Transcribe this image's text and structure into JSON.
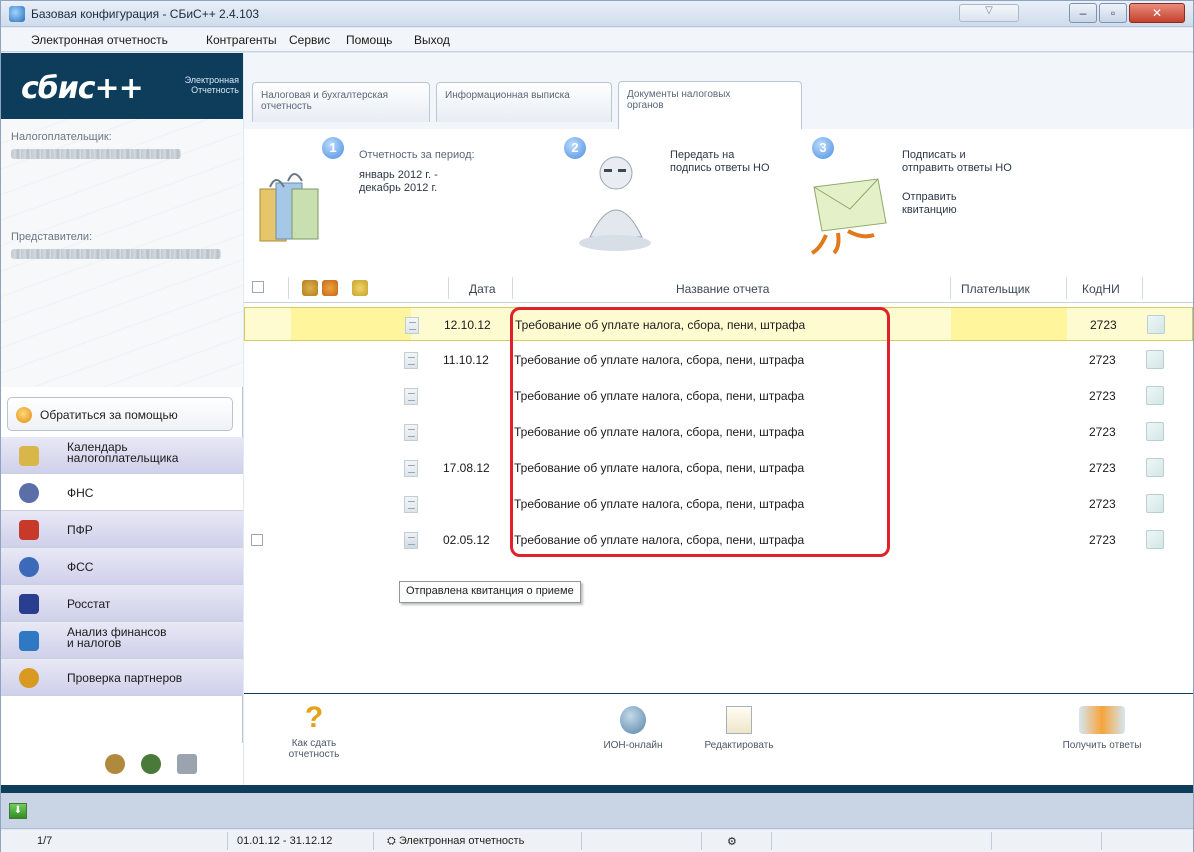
{
  "window": {
    "title": "Базовая конфигурация - СБиС++ 2.4.103",
    "controls": [
      "minimize",
      "maximize",
      "close"
    ]
  },
  "menu": [
    "Электронная отчетность",
    "Контрагенты",
    "Сервис",
    "Помощь",
    "Выход"
  ],
  "brand": {
    "logo": "сбис++",
    "subtitle_line1": "Электронная",
    "subtitle_line2": "Отчетность"
  },
  "sidebar": {
    "taxpayer_label": "Налогоплательщик:",
    "representatives_label": "Представители:",
    "help_button": "Обратиться за помощью",
    "items": [
      {
        "line1": "Календарь",
        "line2": "налогоплательщика",
        "style": "highlighted",
        "icon": "calendar-icon",
        "color": "#d8b64a"
      },
      {
        "line1": "ФНС",
        "line2": "",
        "style": "plain",
        "icon": "fns-emblem-icon",
        "color": "#5b6ea8"
      },
      {
        "line1": "ПФР",
        "line2": "",
        "style": "highlighted",
        "icon": "pfr-icon",
        "color": "#c73a2a"
      },
      {
        "line1": "ФСС",
        "line2": "",
        "style": "highlighted",
        "icon": "fss-icon",
        "color": "#3c69b8"
      },
      {
        "line1": "Росстат",
        "line2": "",
        "style": "highlighted",
        "icon": "rosstat-icon",
        "color": "#2a3e8f"
      },
      {
        "line1": "Анализ финансов",
        "line2": "и налогов",
        "style": "highlighted",
        "icon": "analysis-chart-icon",
        "color": "#2f79c4"
      },
      {
        "line1": "Проверка партнеров",
        "line2": "",
        "style": "highlighted",
        "icon": "partner-check-icon",
        "color": "#d99a23"
      }
    ]
  },
  "tabs": [
    {
      "line1": "Налоговая и бухгалтерская",
      "line2": "отчетность",
      "active": false
    },
    {
      "line1": "Информационная выписка",
      "line2": "",
      "active": false
    },
    {
      "line1": "Документы налоговых",
      "line2": "органов",
      "active": true
    }
  ],
  "steps": [
    {
      "num": "1",
      "lines": [
        "Отчетность за период:",
        "январь 2012 г. -",
        "декабрь 2012 г."
      ]
    },
    {
      "num": "2",
      "lines": [
        "Передать на",
        "подпись ответы НО"
      ]
    },
    {
      "num": "3",
      "lines": [
        "Подписать и",
        "отправить ответы НО"
      ],
      "extra": [
        "Отправить",
        "квитанцию"
      ]
    }
  ],
  "table": {
    "headers": {
      "date": "Дата",
      "name": "Название отчета",
      "payer": "Плательщик",
      "kod": "КодНИ"
    },
    "rows": [
      {
        "date": "12.10.12",
        "name": "Требование об уплате налога, сбора, пени, штрафа",
        "kod": "2723",
        "selected": true
      },
      {
        "date": "11.10.12",
        "name": "Требование об уплате налога, сбора, пени, штрафа",
        "kod": "2723",
        "selected": false
      },
      {
        "date": "",
        "name": "Требование об уплате налога, сбора, пени, штрафа",
        "kod": "2723",
        "selected": false
      },
      {
        "date": "",
        "name": "Требование об уплате налога, сбора, пени, штрафа",
        "kod": "2723",
        "selected": false
      },
      {
        "date": "17.08.12",
        "name": "Требование об уплате налога, сбора, пени, штрафа",
        "kod": "2723",
        "selected": false
      },
      {
        "date": "",
        "name": "Требование об уплате налога, сбора, пени, штрафа",
        "kod": "2723",
        "selected": false
      },
      {
        "date": "02.05.12",
        "name": "Требование об уплате налога, сбора, пени, штрафа",
        "kod": "2723",
        "selected": false
      }
    ],
    "tooltip": "Отправлена квитанция о приеме"
  },
  "toolbar": {
    "how_line1": "Как сдать",
    "how_line2": "отчетность",
    "ion": "ИОН-онлайн",
    "edit": "Редактировать",
    "get_answers": "Получить ответы"
  },
  "status": {
    "page": "1/7",
    "period": "01.01.12 - 31.12.12",
    "section": "Электронная отчетность"
  }
}
